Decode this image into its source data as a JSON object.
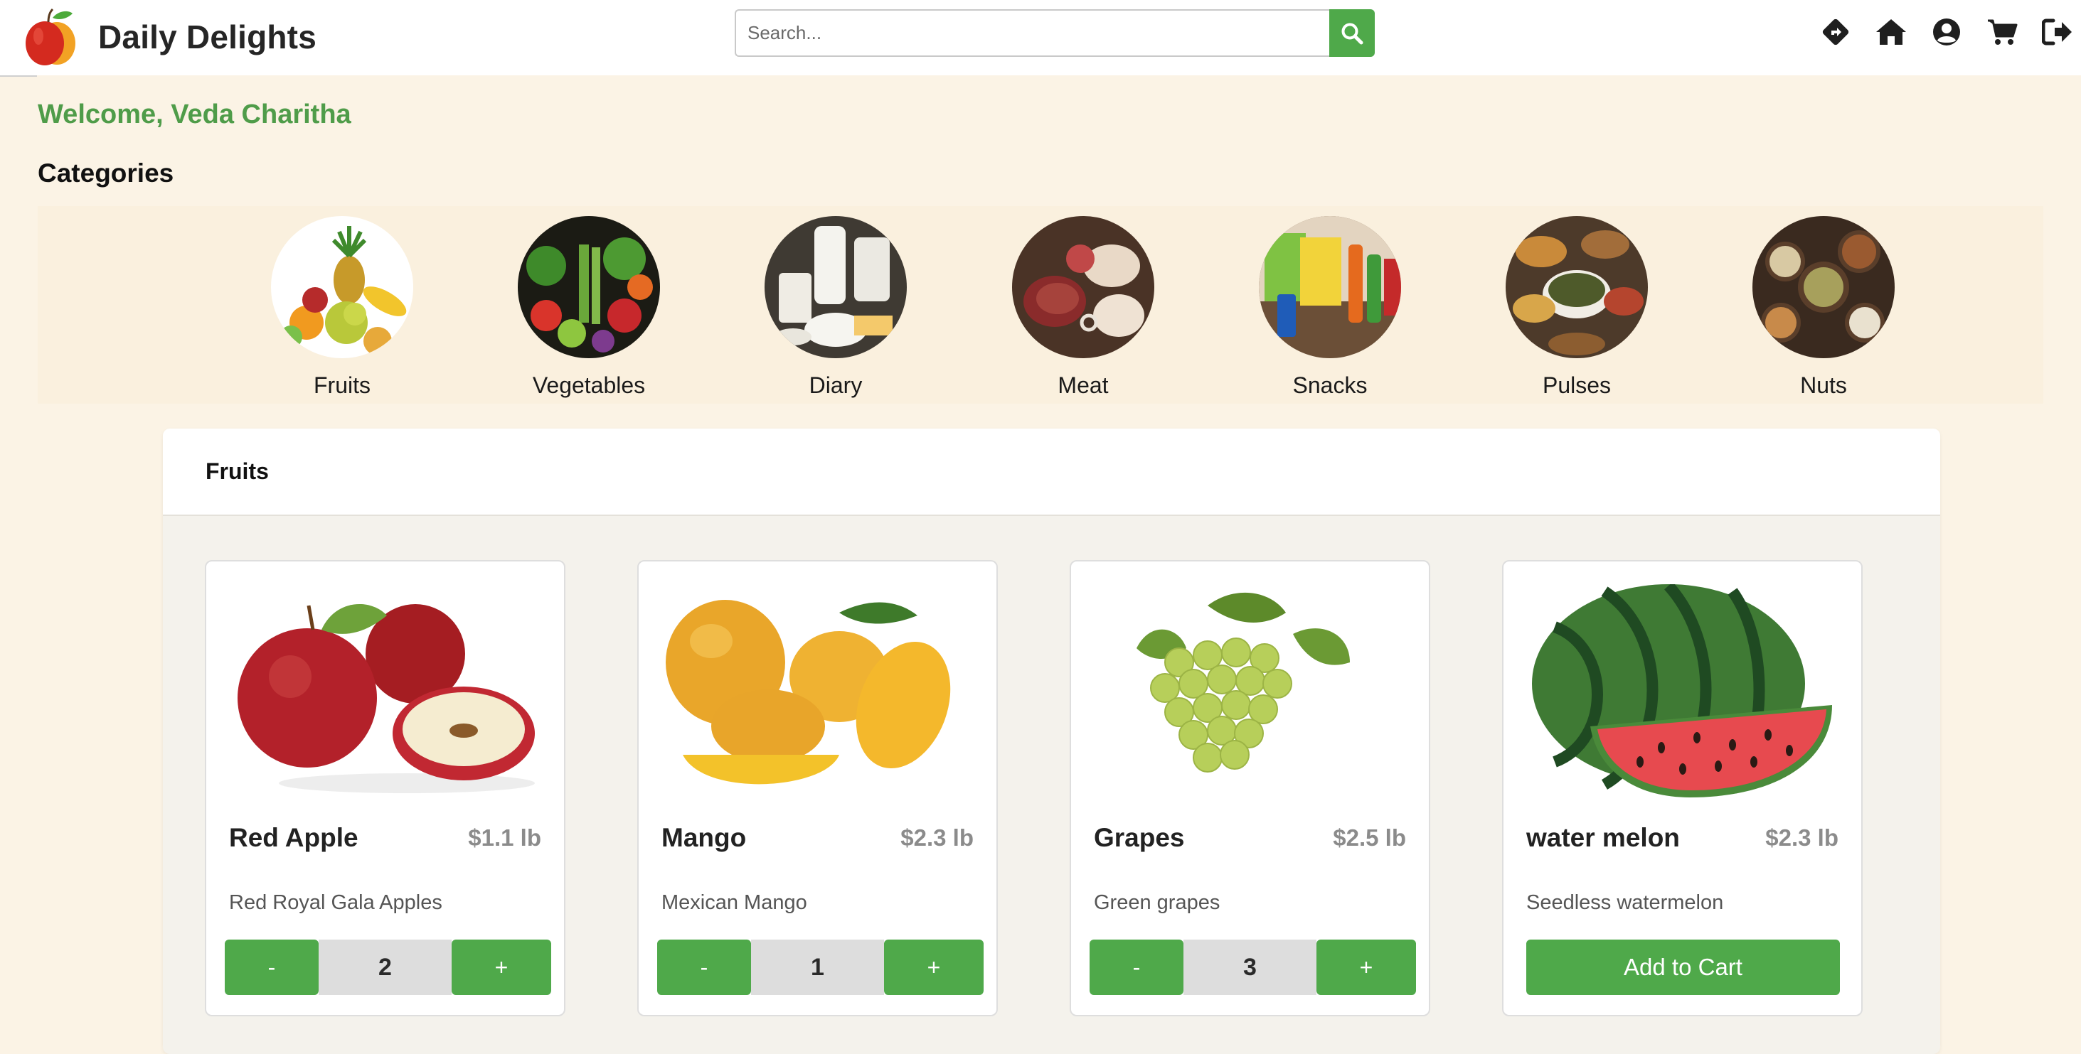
{
  "header": {
    "brand": "Daily Delights",
    "search_placeholder": "Search...",
    "icons": [
      "diamond-direction-icon",
      "home-icon",
      "user-account-icon",
      "cart-icon",
      "logout-icon"
    ]
  },
  "welcome": "Welcome, Veda Charitha",
  "categories": {
    "title": "Categories",
    "items": [
      {
        "label": "Fruits"
      },
      {
        "label": "Vegetables"
      },
      {
        "label": "Diary"
      },
      {
        "label": "Meat"
      },
      {
        "label": "Snacks"
      },
      {
        "label": "Pulses"
      },
      {
        "label": "Nuts"
      }
    ]
  },
  "section": {
    "title": "Fruits",
    "products": [
      {
        "name": "Red Apple",
        "price": "$1.1 lb",
        "description": "Red Royal Gala Apples",
        "quantity": "2",
        "minus": "-",
        "plus": "+"
      },
      {
        "name": "Mango",
        "price": "$2.3 lb",
        "description": "Mexican Mango",
        "quantity": "1",
        "minus": "-",
        "plus": "+"
      },
      {
        "name": "Grapes",
        "price": "$2.5 lb",
        "description": "Green grapes",
        "quantity": "3",
        "minus": "-",
        "plus": "+"
      },
      {
        "name": "water melon",
        "price": "$2.3 lb",
        "description": "Seedless watermelon",
        "add_to_cart": "Add to Cart"
      }
    ]
  },
  "colors": {
    "accent_green": "#4fa94a",
    "welcome_green": "#4f9c49",
    "page_background": "#fbf3e5"
  }
}
